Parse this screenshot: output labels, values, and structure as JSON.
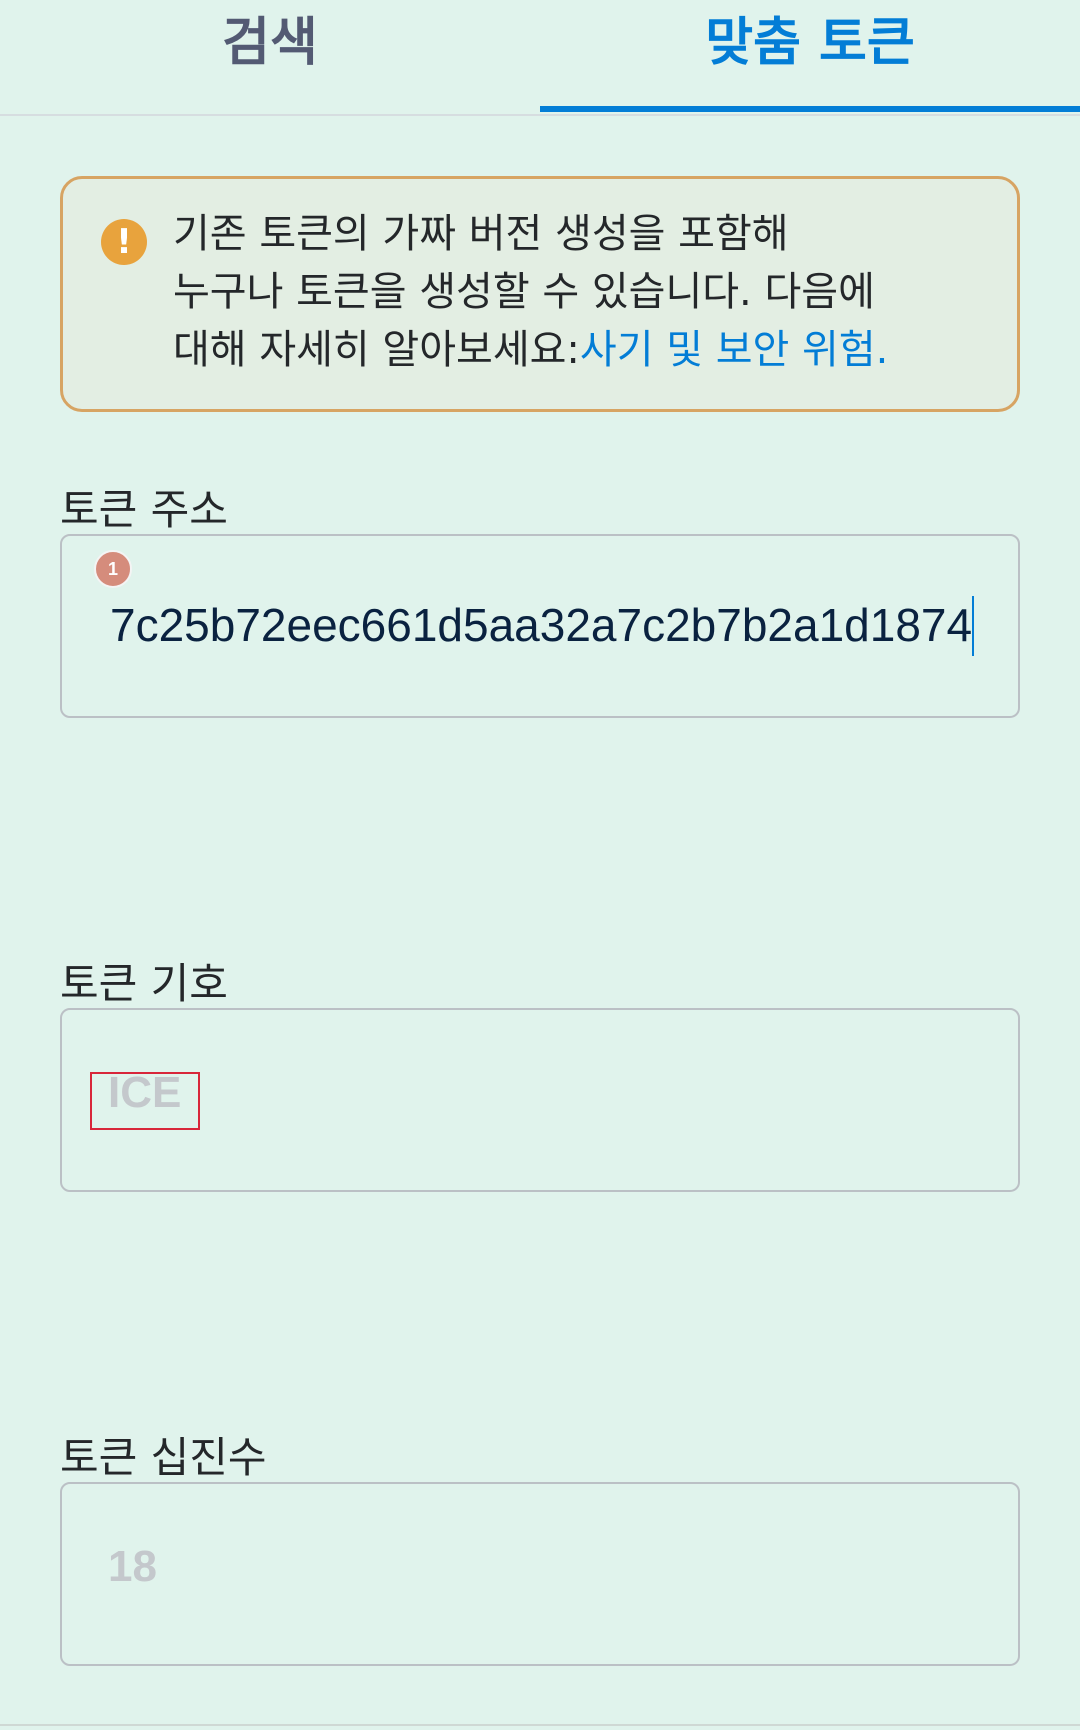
{
  "tabs": {
    "search_label": "검색",
    "custom_label": "맞춤 토큰",
    "active": "custom",
    "accent_color": "#037dd6"
  },
  "warning": {
    "icon": "exclamation-circle-icon",
    "line1": "기존 토큰의 가짜 버전 생성을 포함해",
    "line2": "누구나 토큰을 생성할 수 있습니다. 다음에",
    "line3": "대해 자세히 알아보세요:",
    "link_text": "사기 및 보안 위험."
  },
  "token_address": {
    "label": "토큰 주소",
    "value": "7c25b72eec661d5aa32a7c2b7b2a1d1874",
    "badge": "1"
  },
  "token_symbol": {
    "label": "토큰 기호",
    "placeholder": "ICE"
  },
  "token_decimals": {
    "label": "토큰 십진수",
    "placeholder": "18"
  }
}
